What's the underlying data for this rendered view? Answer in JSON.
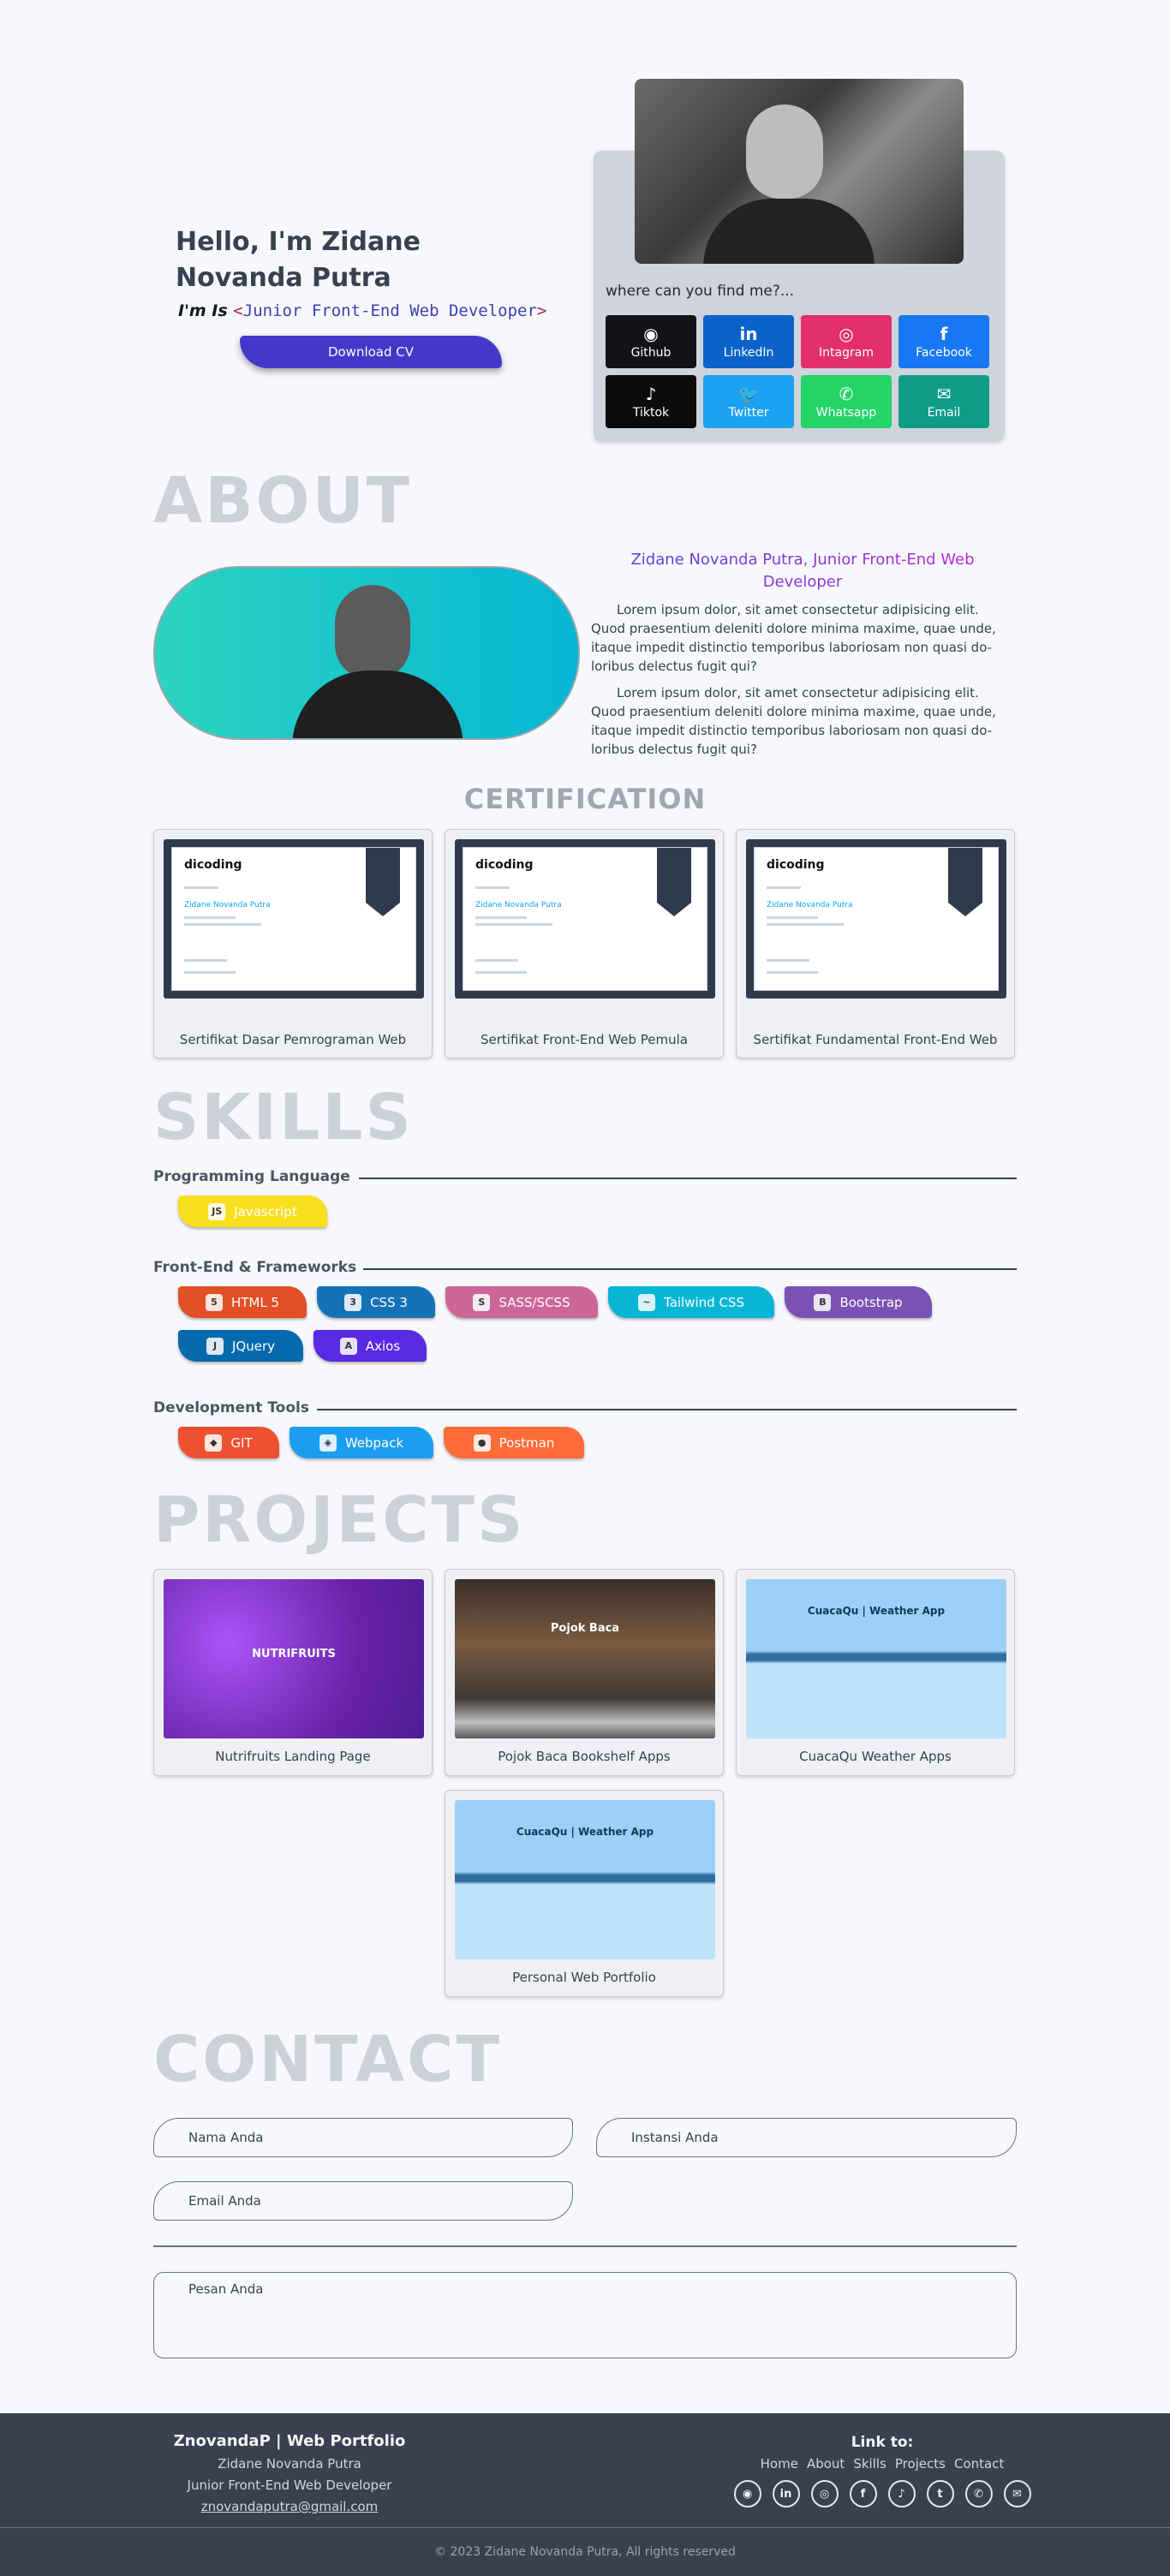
{
  "hero": {
    "greeting": "Hello, I'm Zidane Novanda Putra",
    "iam_prefix": "I'm Is ",
    "role_open": "<",
    "role": "Junior Front-End Web Developer",
    "role_close": ">",
    "download_label": "Download CV",
    "find_me": "where can you find me?...",
    "socials": [
      {
        "label": "Github",
        "icon": "github-icon",
        "glyph": "◉",
        "color": "#111318"
      },
      {
        "label": "LinkedIn",
        "icon": "linkedin-icon",
        "glyph": "in",
        "color": "#0a63c9"
      },
      {
        "label": "Intagram",
        "icon": "instagram-icon",
        "glyph": "◎",
        "color": "#e1306c"
      },
      {
        "label": "Facebook",
        "icon": "facebook-icon",
        "glyph": "f",
        "color": "#1877f2"
      },
      {
        "label": "Tiktok",
        "icon": "tiktok-icon",
        "glyph": "♪",
        "color": "#0b0b0b"
      },
      {
        "label": "Twitter",
        "icon": "twitter-icon",
        "glyph": "🐦",
        "color": "#1da1f2"
      },
      {
        "label": "Whatsapp",
        "icon": "whatsapp-icon",
        "glyph": "✆",
        "color": "#25d366"
      },
      {
        "label": "Email",
        "icon": "email-icon",
        "glyph": "✉",
        "color": "#0f9d8a"
      }
    ]
  },
  "about": {
    "title": "ABOUT",
    "name_line": "Zidane Novanda Putra, Junior Front-End Web Developer",
    "p1": "Lorem ipsum dolor, sit amet consectetur adipisicing elit. Quod praesentium deleniti dolore minima maxime, quae unde, itaque impedit distinctio temporibus laboriosam non quasi do-loribus delectus fugit qui?",
    "p2": "Lorem ipsum dolor, sit amet consectetur adipisicing elit. Quod praesentium deleniti dolore minima maxime, quae unde, itaque impedit distinctio temporibus laboriosam non quasi do-loribus delectus fugit qui?"
  },
  "certification": {
    "title": "CERTIFICATION",
    "items": [
      {
        "caption": "Sertifikat Dasar Pemrograman Web",
        "logo": "dicoding",
        "name": "Zidane Novanda Putra"
      },
      {
        "caption": "Sertifikat Front-End Web Pemula",
        "logo": "dicoding",
        "name": "Zidane Novanda Putra"
      },
      {
        "caption": "Sertifikat Fundamental Front-End Web",
        "logo": "dicoding",
        "name": "Zidane Novanda Putra"
      }
    ]
  },
  "skills": {
    "title": "SKILLS",
    "groups": [
      {
        "title": "Programming Language",
        "items": [
          {
            "label": "Javascript",
            "color": "#f7df1e",
            "icon": "JS"
          }
        ]
      },
      {
        "title": "Front-End & Frameworks",
        "items": [
          {
            "label": "HTML 5",
            "color": "#e34f26",
            "icon": "5"
          },
          {
            "label": "CSS 3",
            "color": "#1572b6",
            "icon": "3"
          },
          {
            "label": "SASS/SCSS",
            "color": "#cc6699",
            "icon": "S"
          },
          {
            "label": "Tailwind CSS",
            "color": "#06b6d4",
            "icon": "~"
          },
          {
            "label": "Bootstrap",
            "color": "#7952b3",
            "icon": "B"
          },
          {
            "label": "JQuery",
            "color": "#0769ad",
            "icon": "J"
          },
          {
            "label": "Axios",
            "color": "#5a29e4",
            "icon": "A"
          }
        ]
      },
      {
        "title": "Development Tools",
        "items": [
          {
            "label": "GIT",
            "color": "#f05032",
            "icon": "◆"
          },
          {
            "label": "Webpack",
            "color": "#1c9ef0",
            "icon": "◈"
          },
          {
            "label": "Postman",
            "color": "#ff6c37",
            "icon": "●"
          }
        ]
      }
    ]
  },
  "projects": {
    "title": "PROJECTS",
    "items": [
      {
        "caption": "Nutrifruits Landing Page",
        "thumb_text": "NUTRIFRUITS"
      },
      {
        "caption": "Pojok Baca Bookshelf Apps",
        "thumb_text": "Pojok Baca"
      },
      {
        "caption": "CuacaQu Weather Apps",
        "thumb_text": "CuacaQu | Weather App"
      },
      {
        "caption": "Personal Web Portfolio",
        "thumb_text": "CuacaQu | Weather App"
      }
    ]
  },
  "contact": {
    "title": "CONTACT",
    "name_ph": "Nama Anda",
    "instansi_ph": "Instansi Anda",
    "email_ph": "Email Anda",
    "msg_ph": "Pesan Anda"
  },
  "footer": {
    "brand": "ZnovandaP | Web Portfolio",
    "name": "Zidane Novanda Putra",
    "role": "Junior Front-End Web Developer",
    "email": "znovandaputra@gmail.com",
    "link_title": "Link to:",
    "links": [
      "Home",
      "About",
      "Skills",
      "Projects",
      "Contact"
    ],
    "icons": [
      {
        "name": "github-icon",
        "glyph": "◉"
      },
      {
        "name": "linkedin-icon",
        "glyph": "in"
      },
      {
        "name": "instagram-icon",
        "glyph": "◎"
      },
      {
        "name": "facebook-icon",
        "glyph": "f"
      },
      {
        "name": "tiktok-icon",
        "glyph": "♪"
      },
      {
        "name": "twitter-icon",
        "glyph": "t"
      },
      {
        "name": "whatsapp-icon",
        "glyph": "✆"
      },
      {
        "name": "email-icon",
        "glyph": "✉"
      }
    ],
    "copyright": "© 2023 Zidane Novanda Putra, All rights reserved"
  }
}
